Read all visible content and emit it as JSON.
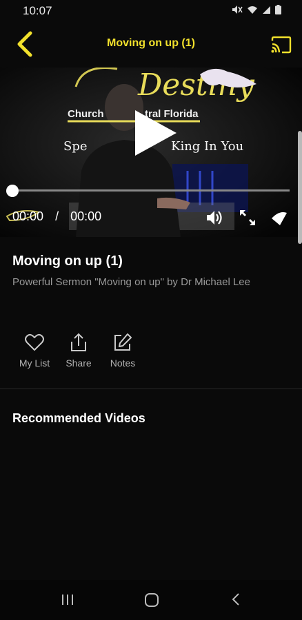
{
  "status": {
    "time": "10:07"
  },
  "header": {
    "title": "Moving on up (1)"
  },
  "player": {
    "current_time": "00:00",
    "separator": "/",
    "duration": "00:00",
    "progress": 0,
    "thumbnail_text": {
      "logo_word": "Destiny",
      "church_line_left": "Church",
      "church_line_right": "tral Florida",
      "tagline_left": "Spe",
      "tagline_right": "King In You"
    }
  },
  "video": {
    "title": "Moving on up (1)",
    "description": "Powerful Sermon \"Moving on up\" by Dr Michael Lee"
  },
  "actions": [
    {
      "label": "My List",
      "icon": "heart-icon"
    },
    {
      "label": "Share",
      "icon": "share-icon"
    },
    {
      "label": "Notes",
      "icon": "edit-icon"
    }
  ],
  "recommended": {
    "heading": "Recommended Videos"
  },
  "colors": {
    "accent": "#f2e12c",
    "background": "#0a0a0a",
    "muted_text": "#9a9a9a"
  }
}
